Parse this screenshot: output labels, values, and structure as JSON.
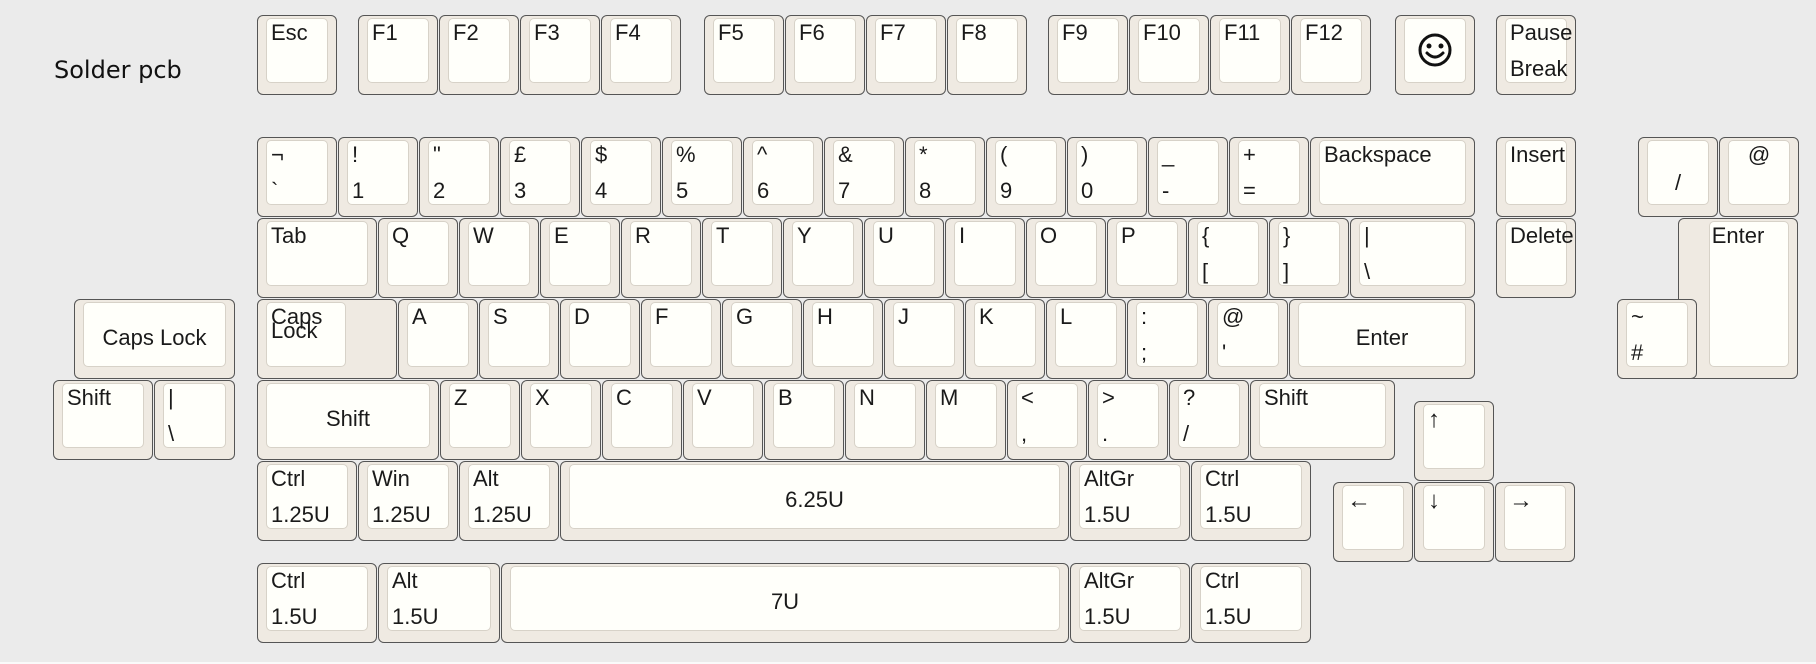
{
  "title": "Solder pcb",
  "keys": [
    {
      "id": "esc",
      "legends": [
        {
          "text": "Esc",
          "pos": "tl"
        }
      ]
    },
    {
      "id": "f1",
      "legends": [
        {
          "text": "F1",
          "pos": "tl"
        }
      ]
    },
    {
      "id": "f2",
      "legends": [
        {
          "text": "F2",
          "pos": "tl"
        }
      ]
    },
    {
      "id": "f3",
      "legends": [
        {
          "text": "F3",
          "pos": "tl"
        }
      ]
    },
    {
      "id": "f4",
      "legends": [
        {
          "text": "F4",
          "pos": "tl"
        }
      ]
    },
    {
      "id": "f5",
      "legends": [
        {
          "text": "F5",
          "pos": "tl"
        }
      ]
    },
    {
      "id": "f6",
      "legends": [
        {
          "text": "F6",
          "pos": "tl"
        }
      ]
    },
    {
      "id": "f7",
      "legends": [
        {
          "text": "F7",
          "pos": "tl"
        }
      ]
    },
    {
      "id": "f8",
      "legends": [
        {
          "text": "F8",
          "pos": "tl"
        }
      ]
    },
    {
      "id": "f9",
      "legends": [
        {
          "text": "F9",
          "pos": "tl"
        }
      ]
    },
    {
      "id": "f10",
      "legends": [
        {
          "text": "F10",
          "pos": "tl"
        }
      ]
    },
    {
      "id": "f11",
      "legends": [
        {
          "text": "F11",
          "pos": "tl"
        }
      ]
    },
    {
      "id": "f12",
      "legends": [
        {
          "text": "F12",
          "pos": "tl"
        }
      ]
    },
    {
      "id": "smiley",
      "icon": "smiley-icon",
      "legends": []
    },
    {
      "id": "pause",
      "legends": [
        {
          "text": "Pause",
          "pos": "tl"
        },
        {
          "text": "Break",
          "pos": "bl"
        }
      ]
    },
    {
      "id": "grave",
      "legends": [
        {
          "text": "¬",
          "pos": "tl"
        },
        {
          "text": "`",
          "pos": "bl"
        }
      ]
    },
    {
      "id": "n1",
      "legends": [
        {
          "text": "!",
          "pos": "tl"
        },
        {
          "text": "1",
          "pos": "bl"
        }
      ]
    },
    {
      "id": "n2",
      "legends": [
        {
          "text": "\"",
          "pos": "tl"
        },
        {
          "text": "2",
          "pos": "bl"
        }
      ]
    },
    {
      "id": "n3",
      "legends": [
        {
          "text": "£",
          "pos": "tl"
        },
        {
          "text": "3",
          "pos": "bl"
        }
      ]
    },
    {
      "id": "n4",
      "legends": [
        {
          "text": "$",
          "pos": "tl"
        },
        {
          "text": "4",
          "pos": "bl"
        }
      ]
    },
    {
      "id": "n5",
      "legends": [
        {
          "text": "%",
          "pos": "tl"
        },
        {
          "text": "5",
          "pos": "bl"
        }
      ]
    },
    {
      "id": "n6",
      "legends": [
        {
          "text": "^",
          "pos": "tl"
        },
        {
          "text": "6",
          "pos": "bl"
        }
      ]
    },
    {
      "id": "n7",
      "legends": [
        {
          "text": "&",
          "pos": "tl"
        },
        {
          "text": "7",
          "pos": "bl"
        }
      ]
    },
    {
      "id": "n8",
      "legends": [
        {
          "text": "*",
          "pos": "tl"
        },
        {
          "text": "8",
          "pos": "bl"
        }
      ]
    },
    {
      "id": "n9",
      "legends": [
        {
          "text": "(",
          "pos": "tl"
        },
        {
          "text": "9",
          "pos": "bl"
        }
      ]
    },
    {
      "id": "n0",
      "legends": [
        {
          "text": ")",
          "pos": "tl"
        },
        {
          "text": "0",
          "pos": "bl"
        }
      ]
    },
    {
      "id": "minus",
      "legends": [
        {
          "text": "_",
          "pos": "tl"
        },
        {
          "text": "-",
          "pos": "bl"
        }
      ]
    },
    {
      "id": "equal",
      "legends": [
        {
          "text": "+",
          "pos": "tl"
        },
        {
          "text": "=",
          "pos": "bl"
        }
      ]
    },
    {
      "id": "backspace",
      "legends": [
        {
          "text": "Backspace",
          "pos": "tl"
        }
      ]
    },
    {
      "id": "insert",
      "legends": [
        {
          "text": "Insert",
          "pos": "tl"
        }
      ]
    },
    {
      "id": "np-slash",
      "legends": [
        {
          "text": "/",
          "pos": "c"
        }
      ]
    },
    {
      "id": "np-at",
      "legends": [
        {
          "text": "@",
          "pos": "tc"
        }
      ]
    },
    {
      "id": "tab",
      "legends": [
        {
          "text": "Tab",
          "pos": "tl"
        }
      ]
    },
    {
      "id": "q",
      "legends": [
        {
          "text": "Q",
          "pos": "tl"
        }
      ]
    },
    {
      "id": "w",
      "legends": [
        {
          "text": "W",
          "pos": "tl"
        }
      ]
    },
    {
      "id": "e",
      "legends": [
        {
          "text": "E",
          "pos": "tl"
        }
      ]
    },
    {
      "id": "r",
      "legends": [
        {
          "text": "R",
          "pos": "tl"
        }
      ]
    },
    {
      "id": "t",
      "legends": [
        {
          "text": "T",
          "pos": "tl"
        }
      ]
    },
    {
      "id": "y",
      "legends": [
        {
          "text": "Y",
          "pos": "tl"
        }
      ]
    },
    {
      "id": "u",
      "legends": [
        {
          "text": "U",
          "pos": "tl"
        }
      ]
    },
    {
      "id": "i",
      "legends": [
        {
          "text": "I",
          "pos": "tl"
        }
      ]
    },
    {
      "id": "o",
      "legends": [
        {
          "text": "O",
          "pos": "tl"
        }
      ]
    },
    {
      "id": "p",
      "legends": [
        {
          "text": "P",
          "pos": "tl"
        }
      ]
    },
    {
      "id": "lbracket",
      "legends": [
        {
          "text": "{",
          "pos": "tl"
        },
        {
          "text": "[",
          "pos": "bl"
        }
      ]
    },
    {
      "id": "rbracket",
      "legends": [
        {
          "text": "}",
          "pos": "tl"
        },
        {
          "text": "]",
          "pos": "bl"
        }
      ]
    },
    {
      "id": "backslash",
      "legends": [
        {
          "text": "|",
          "pos": "tl"
        },
        {
          "text": "\\",
          "pos": "bl"
        }
      ]
    },
    {
      "id": "delete",
      "legends": [
        {
          "text": "Delete",
          "pos": "tl"
        }
      ]
    },
    {
      "id": "np-enter",
      "legends": [
        {
          "text": "Enter",
          "pos": "tc"
        }
      ]
    },
    {
      "id": "capslock-alt",
      "legends": [
        {
          "text": "Caps Lock",
          "pos": "c"
        }
      ]
    },
    {
      "id": "capslock",
      "legends": [
        {
          "text": "Caps",
          "pos": "tl"
        },
        {
          "text": "Lock",
          "pos": "tl2"
        }
      ]
    },
    {
      "id": "a",
      "legends": [
        {
          "text": "A",
          "pos": "tl"
        }
      ]
    },
    {
      "id": "s",
      "legends": [
        {
          "text": "S",
          "pos": "tl"
        }
      ]
    },
    {
      "id": "d",
      "legends": [
        {
          "text": "D",
          "pos": "tl"
        }
      ]
    },
    {
      "id": "f",
      "legends": [
        {
          "text": "F",
          "pos": "tl"
        }
      ]
    },
    {
      "id": "g",
      "legends": [
        {
          "text": "G",
          "pos": "tl"
        }
      ]
    },
    {
      "id": "h",
      "legends": [
        {
          "text": "H",
          "pos": "tl"
        }
      ]
    },
    {
      "id": "j",
      "legends": [
        {
          "text": "J",
          "pos": "tl"
        }
      ]
    },
    {
      "id": "k",
      "legends": [
        {
          "text": "K",
          "pos": "tl"
        }
      ]
    },
    {
      "id": "l",
      "legends": [
        {
          "text": "L",
          "pos": "tl"
        }
      ]
    },
    {
      "id": "semicolon",
      "legends": [
        {
          "text": ":",
          "pos": "tl"
        },
        {
          "text": ";",
          "pos": "bl"
        }
      ]
    },
    {
      "id": "quote",
      "legends": [
        {
          "text": "@",
          "pos": "tl"
        },
        {
          "text": "'",
          "pos": "bl"
        }
      ]
    },
    {
      "id": "enter",
      "legends": [
        {
          "text": "Enter",
          "pos": "c"
        }
      ]
    },
    {
      "id": "np-hash",
      "legends": [
        {
          "text": "~",
          "pos": "tl"
        },
        {
          "text": "#",
          "pos": "bl"
        }
      ]
    },
    {
      "id": "lshift-split",
      "legends": [
        {
          "text": "Shift",
          "pos": "tl"
        }
      ]
    },
    {
      "id": "iso-pipe",
      "legends": [
        {
          "text": "|",
          "pos": "tl"
        },
        {
          "text": "\\",
          "pos": "bl"
        }
      ]
    },
    {
      "id": "lshift",
      "legends": [
        {
          "text": "Shift",
          "pos": "c"
        }
      ]
    },
    {
      "id": "z",
      "legends": [
        {
          "text": "Z",
          "pos": "tl"
        }
      ]
    },
    {
      "id": "x",
      "legends": [
        {
          "text": "X",
          "pos": "tl"
        }
      ]
    },
    {
      "id": "c",
      "legends": [
        {
          "text": "C",
          "pos": "tl"
        }
      ]
    },
    {
      "id": "v",
      "legends": [
        {
          "text": "V",
          "pos": "tl"
        }
      ]
    },
    {
      "id": "b",
      "legends": [
        {
          "text": "B",
          "pos": "tl"
        }
      ]
    },
    {
      "id": "n",
      "legends": [
        {
          "text": "N",
          "pos": "tl"
        }
      ]
    },
    {
      "id": "m",
      "legends": [
        {
          "text": "M",
          "pos": "tl"
        }
      ]
    },
    {
      "id": "comma",
      "legends": [
        {
          "text": "<",
          "pos": "tl"
        },
        {
          "text": ",",
          "pos": "bl"
        }
      ]
    },
    {
      "id": "period",
      "legends": [
        {
          "text": ">",
          "pos": "tl"
        },
        {
          "text": ".",
          "pos": "bl"
        }
      ]
    },
    {
      "id": "slash",
      "legends": [
        {
          "text": "?",
          "pos": "tl"
        },
        {
          "text": "/",
          "pos": "bl"
        }
      ]
    },
    {
      "id": "rshift",
      "legends": [
        {
          "text": "Shift",
          "pos": "tl"
        }
      ]
    },
    {
      "id": "up",
      "legends": [
        {
          "text": "↑",
          "pos": "tl"
        }
      ]
    },
    {
      "id": "lctrl-125",
      "legends": [
        {
          "text": "Ctrl",
          "pos": "tl"
        },
        {
          "text": "1.25U",
          "pos": "bl"
        }
      ]
    },
    {
      "id": "win-125",
      "legends": [
        {
          "text": "Win",
          "pos": "tl"
        },
        {
          "text": "1.25U",
          "pos": "bl"
        }
      ]
    },
    {
      "id": "alt-125",
      "legends": [
        {
          "text": "Alt",
          "pos": "tl"
        },
        {
          "text": "1.25U",
          "pos": "bl"
        }
      ]
    },
    {
      "id": "space-625",
      "legends": [
        {
          "text": "6.25U",
          "pos": "c"
        }
      ]
    },
    {
      "id": "altgr-15a",
      "legends": [
        {
          "text": "AltGr",
          "pos": "tl"
        },
        {
          "text": "1.5U",
          "pos": "bl"
        }
      ]
    },
    {
      "id": "rctrl-15a",
      "legends": [
        {
          "text": "Ctrl",
          "pos": "tl"
        },
        {
          "text": "1.5U",
          "pos": "bl"
        }
      ]
    },
    {
      "id": "left",
      "legends": [
        {
          "text": "←",
          "pos": "tl"
        }
      ]
    },
    {
      "id": "down",
      "legends": [
        {
          "text": "↓",
          "pos": "tl"
        }
      ]
    },
    {
      "id": "right",
      "legends": [
        {
          "text": "→",
          "pos": "tl"
        }
      ]
    },
    {
      "id": "lctrl-15",
      "legends": [
        {
          "text": "Ctrl",
          "pos": "tl"
        },
        {
          "text": "1.5U",
          "pos": "bl"
        }
      ]
    },
    {
      "id": "alt-15",
      "legends": [
        {
          "text": "Alt",
          "pos": "tl"
        },
        {
          "text": "1.5U",
          "pos": "bl"
        }
      ]
    },
    {
      "id": "space-7",
      "legends": [
        {
          "text": "7U",
          "pos": "c"
        }
      ]
    },
    {
      "id": "altgr-15b",
      "legends": [
        {
          "text": "AltGr",
          "pos": "tl"
        },
        {
          "text": "1.5U",
          "pos": "bl"
        }
      ]
    },
    {
      "id": "rctrl-15b",
      "legends": [
        {
          "text": "Ctrl",
          "pos": "tl"
        },
        {
          "text": "1.5U",
          "pos": "bl"
        }
      ]
    }
  ]
}
